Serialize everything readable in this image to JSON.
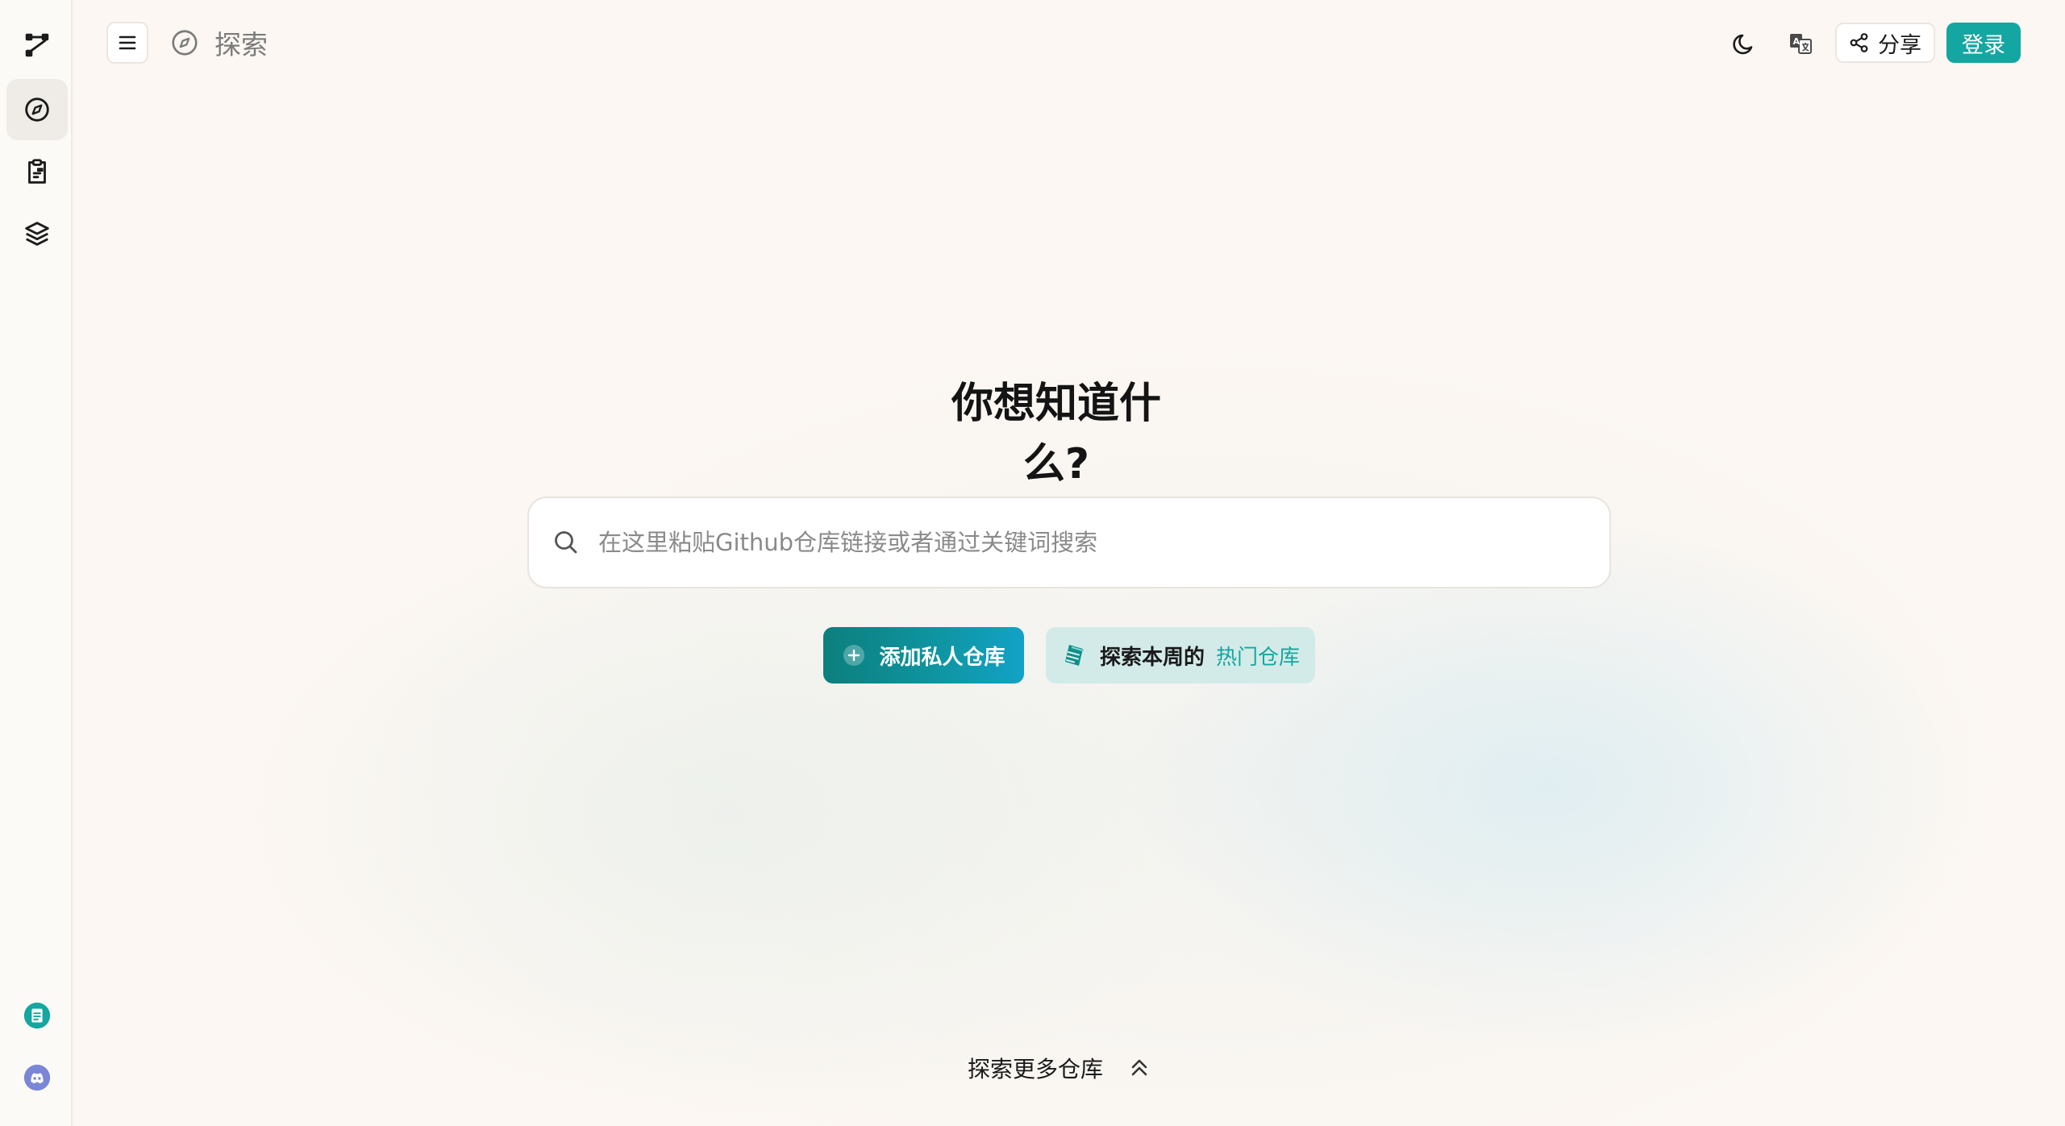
{
  "header": {
    "breadcrumb_label": "探索",
    "share_label": "分享",
    "login_label": "登录"
  },
  "sidebar": {
    "items": [
      {
        "name": "logo",
        "icon": "branch-logo-icon"
      },
      {
        "name": "explore",
        "icon": "compass-icon",
        "active": true
      },
      {
        "name": "clipboard",
        "icon": "clipboard-icon"
      },
      {
        "name": "layers",
        "icon": "layers-stack-icon"
      }
    ],
    "bottom": [
      {
        "name": "docs",
        "icon": "document-badge-icon",
        "color": "#14a6a0"
      },
      {
        "name": "discord",
        "icon": "discord-icon",
        "color": "#7a86d6"
      }
    ]
  },
  "main": {
    "title": "你想知道什么?",
    "search_placeholder": "在这里粘贴Github仓库链接或者通过关键词搜索",
    "add_button_label": "添加私人仓库",
    "trending_prefix": "探索本周的",
    "trending_highlight": "热门仓库",
    "more_label": "探索更多仓库"
  },
  "colors": {
    "accent": "#14a6a0",
    "background": "#fcf7f3"
  }
}
